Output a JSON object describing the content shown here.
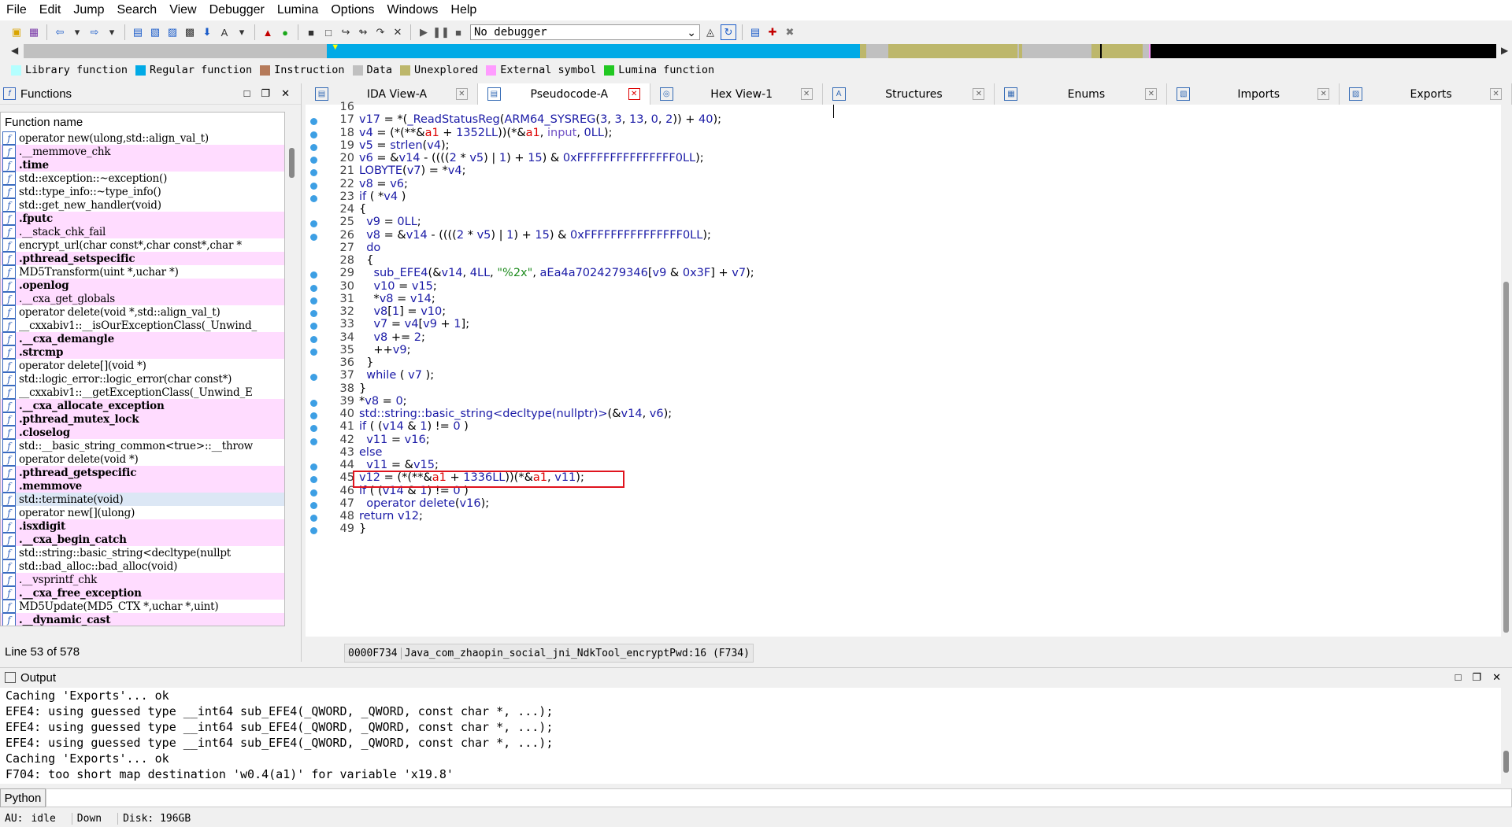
{
  "menu": [
    "File",
    "Edit",
    "Jump",
    "Search",
    "View",
    "Debugger",
    "Lumina",
    "Options",
    "Windows",
    "Help"
  ],
  "toolbar": {
    "debugger_value": "No debugger"
  },
  "nav_colors": {
    "library": "#b4ffff",
    "regular": "#00aae6",
    "instruction": "#b57a5a",
    "data": "#c0c0c0",
    "unexplored": "#bdb76b",
    "external": "#ff9cff",
    "lumina": "#22c822"
  },
  "legend": [
    {
      "label": "Library function",
      "color": "#b4ffff"
    },
    {
      "label": "Regular function",
      "color": "#00aae6"
    },
    {
      "label": "Instruction",
      "color": "#b57a5a"
    },
    {
      "label": "Data",
      "color": "#c0c0c0"
    },
    {
      "label": "Unexplored",
      "color": "#bdb76b"
    },
    {
      "label": "External symbol",
      "color": "#ff9cff"
    },
    {
      "label": "Lumina function",
      "color": "#22c822"
    }
  ],
  "functions": {
    "title": "Functions",
    "column_header": "Function name",
    "status": "Line 53 of 578",
    "items": [
      {
        "name": "operator new(ulong,std::align_val_t)",
        "style": ""
      },
      {
        "name": ".__memmove_chk",
        "style": "pink"
      },
      {
        "name": ".time",
        "style": "pink bold"
      },
      {
        "name": "std::exception::~exception()",
        "style": ""
      },
      {
        "name": "std::type_info::~type_info()",
        "style": ""
      },
      {
        "name": "std::get_new_handler(void)",
        "style": ""
      },
      {
        "name": ".fputc",
        "style": "pink bold"
      },
      {
        "name": ".__stack_chk_fail",
        "style": "pink"
      },
      {
        "name": "encrypt_url(char const*,char const*,char *",
        "style": ""
      },
      {
        "name": ".pthread_setspecific",
        "style": "pink bold"
      },
      {
        "name": "MD5Transform(uint *,uchar *)",
        "style": ""
      },
      {
        "name": ".openlog",
        "style": "pink bold"
      },
      {
        "name": ".__cxa_get_globals",
        "style": "pink"
      },
      {
        "name": "operator delete(void *,std::align_val_t)",
        "style": ""
      },
      {
        "name": "__cxxabiv1::__isOurExceptionClass(_Unwind_",
        "style": ""
      },
      {
        "name": ".__cxa_demangle",
        "style": "pink bold"
      },
      {
        "name": ".strcmp",
        "style": "pink bold"
      },
      {
        "name": "operator delete[](void *)",
        "style": ""
      },
      {
        "name": "std::logic_error::logic_error(char const*)",
        "style": ""
      },
      {
        "name": "__cxxabiv1::__getExceptionClass(_Unwind_E",
        "style": ""
      },
      {
        "name": ".__cxa_allocate_exception",
        "style": "pink bold"
      },
      {
        "name": ".pthread_mutex_lock",
        "style": "pink bold"
      },
      {
        "name": ".closelog",
        "style": "pink bold"
      },
      {
        "name": "std::__basic_string_common<true>::__throw",
        "style": ""
      },
      {
        "name": "operator delete(void *)",
        "style": ""
      },
      {
        "name": ".pthread_getspecific",
        "style": "pink bold"
      },
      {
        "name": ".memmove",
        "style": "pink bold"
      },
      {
        "name": "std::terminate(void)",
        "style": "sel"
      },
      {
        "name": "operator new[](ulong)",
        "style": ""
      },
      {
        "name": ".isxdigit",
        "style": "pink bold"
      },
      {
        "name": ".__cxa_begin_catch",
        "style": "pink bold"
      },
      {
        "name": "std::string::basic_string<decltype(nullpt",
        "style": ""
      },
      {
        "name": "std::bad_alloc::bad_alloc(void)",
        "style": ""
      },
      {
        "name": ".__vsprintf_chk",
        "style": "pink"
      },
      {
        "name": ".__cxa_free_exception",
        "style": "pink bold"
      },
      {
        "name": "MD5Update(MD5_CTX *,uchar *,uint)",
        "style": ""
      },
      {
        "name": ".__dynamic_cast",
        "style": "pink bold"
      }
    ]
  },
  "tabs": [
    {
      "label": "IDA View-A",
      "icon": "ida-view-icon",
      "glyph": "▤",
      "active": false
    },
    {
      "label": "Pseudocode-A",
      "icon": "pseudocode-icon",
      "glyph": "▤",
      "active": true
    },
    {
      "label": "Hex View-1",
      "icon": "hex-view-icon",
      "glyph": "◎",
      "active": false
    },
    {
      "label": "Structures",
      "icon": "structures-icon",
      "glyph": "A",
      "active": false
    },
    {
      "label": "Enums",
      "icon": "enums-icon",
      "glyph": "▦",
      "active": false
    },
    {
      "label": "Imports",
      "icon": "imports-icon",
      "glyph": "▧",
      "active": false
    },
    {
      "label": "Exports",
      "icon": "exports-icon",
      "glyph": "▨",
      "active": false
    }
  ],
  "code": {
    "lines": [
      {
        "n": "16",
        "dot": false,
        "html": ""
      },
      {
        "n": "17",
        "dot": true,
        "html": "<span class='v'>v17</span> = *(<span class='v'>_ReadStatusReg</span>(<span class='v'>ARM64_SYSREG</span>(<span class='v'>3</span>, <span class='v'>3</span>, <span class='v'>13</span>, <span class='v'>0</span>, <span class='v'>2</span>)) + <span class='v'>40</span>);"
      },
      {
        "n": "18",
        "dot": true,
        "html": "<span class='v'>v4</span> = (*(**&amp;<span class='r'>a1</span> + <span class='v'>1352LL</span>))(*&amp;<span class='r'>a1</span>, <span class='p'>input</span>, <span class='v'>0LL</span>);"
      },
      {
        "n": "19",
        "dot": true,
        "html": "<span class='v'>v5</span> = <span class='v'>strlen</span>(<span class='v'>v4</span>);"
      },
      {
        "n": "20",
        "dot": true,
        "html": "<span class='v'>v6</span> = &amp;<span class='v'>v14</span> - ((((<span class='v'>2</span> * <span class='v'>v5</span>) | <span class='v'>1</span>) + <span class='v'>15</span>) &amp; <span class='v'>0xFFFFFFFFFFFFFFF0LL</span>);"
      },
      {
        "n": "21",
        "dot": true,
        "html": "<span class='v'>LOBYTE</span>(<span class='v'>v7</span>) = *<span class='v'>v4</span>;"
      },
      {
        "n": "22",
        "dot": true,
        "html": "<span class='v'>v8</span> = <span class='v'>v6</span>;"
      },
      {
        "n": "23",
        "dot": true,
        "html": "<span class='v'>if</span> ( *<span class='v'>v4</span> )"
      },
      {
        "n": "24",
        "dot": false,
        "html": "{"
      },
      {
        "n": "25",
        "dot": true,
        "html": "  <span class='v'>v9</span> = <span class='v'>0LL</span>;"
      },
      {
        "n": "26",
        "dot": true,
        "html": "  <span class='v'>v8</span> = &amp;<span class='v'>v14</span> - ((((<span class='v'>2</span> * <span class='v'>v5</span>) | <span class='v'>1</span>) + <span class='v'>15</span>) &amp; <span class='v'>0xFFFFFFFFFFFFFFF0LL</span>);"
      },
      {
        "n": "27",
        "dot": false,
        "html": "  <span class='v'>do</span>"
      },
      {
        "n": "28",
        "dot": false,
        "html": "  {"
      },
      {
        "n": "29",
        "dot": true,
        "html": "    <span class='v'>sub_EFE4</span>(&amp;<span class='v'>v14</span>, <span class='v'>4LL</span>, <span class='g'>\"%2x\"</span>, <span class='v'>aEa4a7024279346</span>[<span class='v'>v9</span> &amp; <span class='v'>0x3F</span>] + <span class='v'>v7</span>);"
      },
      {
        "n": "30",
        "dot": true,
        "html": "    <span class='v'>v10</span> = <span class='v'>v15</span>;"
      },
      {
        "n": "31",
        "dot": true,
        "html": "    *<span class='v'>v8</span> = <span class='v'>v14</span>;"
      },
      {
        "n": "32",
        "dot": true,
        "html": "    <span class='v'>v8</span>[<span class='v'>1</span>] = <span class='v'>v10</span>;"
      },
      {
        "n": "33",
        "dot": true,
        "html": "    <span class='v'>v7</span> = <span class='v'>v4</span>[<span class='v'>v9</span> + <span class='v'>1</span>];"
      },
      {
        "n": "34",
        "dot": true,
        "html": "    <span class='v'>v8</span> += <span class='v'>2</span>;"
      },
      {
        "n": "35",
        "dot": true,
        "html": "    ++<span class='v'>v9</span>;"
      },
      {
        "n": "36",
        "dot": false,
        "html": "  }"
      },
      {
        "n": "37",
        "dot": true,
        "html": "  <span class='v'>while</span> ( <span class='v'>v7</span> );"
      },
      {
        "n": "38",
        "dot": false,
        "html": "}"
      },
      {
        "n": "39",
        "dot": true,
        "html": "*<span class='v'>v8</span> = <span class='v'>0</span>;"
      },
      {
        "n": "40",
        "dot": true,
        "html": "<span class='v'>std::string::basic_string&lt;decltype(nullptr)&gt;</span>(&amp;<span class='v'>v14</span>, <span class='v'>v6</span>);"
      },
      {
        "n": "41",
        "dot": true,
        "html": "<span class='v'>if</span> ( (<span class='v'>v14</span> &amp; <span class='v'>1</span>) != <span class='v'>0</span> )"
      },
      {
        "n": "42",
        "dot": true,
        "html": "  <span class='v'>v11</span> = <span class='v'>v16</span>;"
      },
      {
        "n": "43",
        "dot": false,
        "html": "<span class='v'>else</span>"
      },
      {
        "n": "44",
        "dot": true,
        "html": "  <span class='v'>v11</span> = &amp;<span class='v'>v15</span>;"
      },
      {
        "n": "45",
        "dot": true,
        "html": "<span class='v'>v12</span> = (*(**&amp;<span class='r'>a1</span> + <span class='v'>1336LL</span>))(*&amp;<span class='r'>a1</span>, <span class='v'>v11</span>);"
      },
      {
        "n": "46",
        "dot": true,
        "html": "<span class='v'>if</span> ( (<span class='v'>v14</span> &amp; <span class='v'>1</span>) != <span class='v'>0</span> )"
      },
      {
        "n": "47",
        "dot": true,
        "html": "  <span class='v'>operator delete</span>(<span class='v'>v16</span>);"
      },
      {
        "n": "48",
        "dot": true,
        "html": "<span class='v'>return</span> <span class='v'>v12</span>;"
      },
      {
        "n": "49",
        "dot": true,
        "html": "}"
      }
    ],
    "status": {
      "address": "0000F734",
      "location": "Java_com_zhaopin_social_jni_NdkTool_encryptPwd:16 (F734)"
    }
  },
  "output": {
    "title": "Output",
    "lines": [
      "Caching 'Exports'... ok",
      "EFE4: using guessed type __int64 sub_EFE4(_QWORD, _QWORD, const char *, ...);",
      "EFE4: using guessed type __int64 sub_EFE4(_QWORD, _QWORD, const char *, ...);",
      "EFE4: using guessed type __int64 sub_EFE4(_QWORD, _QWORD, const char *, ...);",
      "Caching 'Exports'... ok",
      "F704: too short map destination 'w0.4(a1)' for variable 'x19.8'"
    ],
    "python_label": "Python"
  },
  "statusbar": {
    "au": "AU:",
    "state": "idle",
    "direction": "Down",
    "disk": "Disk: 196GB"
  }
}
